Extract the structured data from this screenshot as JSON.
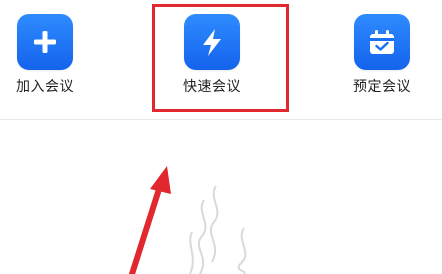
{
  "actions": [
    {
      "id": "join",
      "label": "加入会议",
      "icon": "plus-icon"
    },
    {
      "id": "quick",
      "label": "快速会议",
      "icon": "lightning-bolt-icon"
    },
    {
      "id": "schedule",
      "label": "预定会议",
      "icon": "calendar-check-icon"
    }
  ],
  "colors": {
    "tile": "#1a6ff5",
    "highlight": "#e0282e",
    "arrow": "#e0282e",
    "watermark": "#d9d9d9"
  }
}
